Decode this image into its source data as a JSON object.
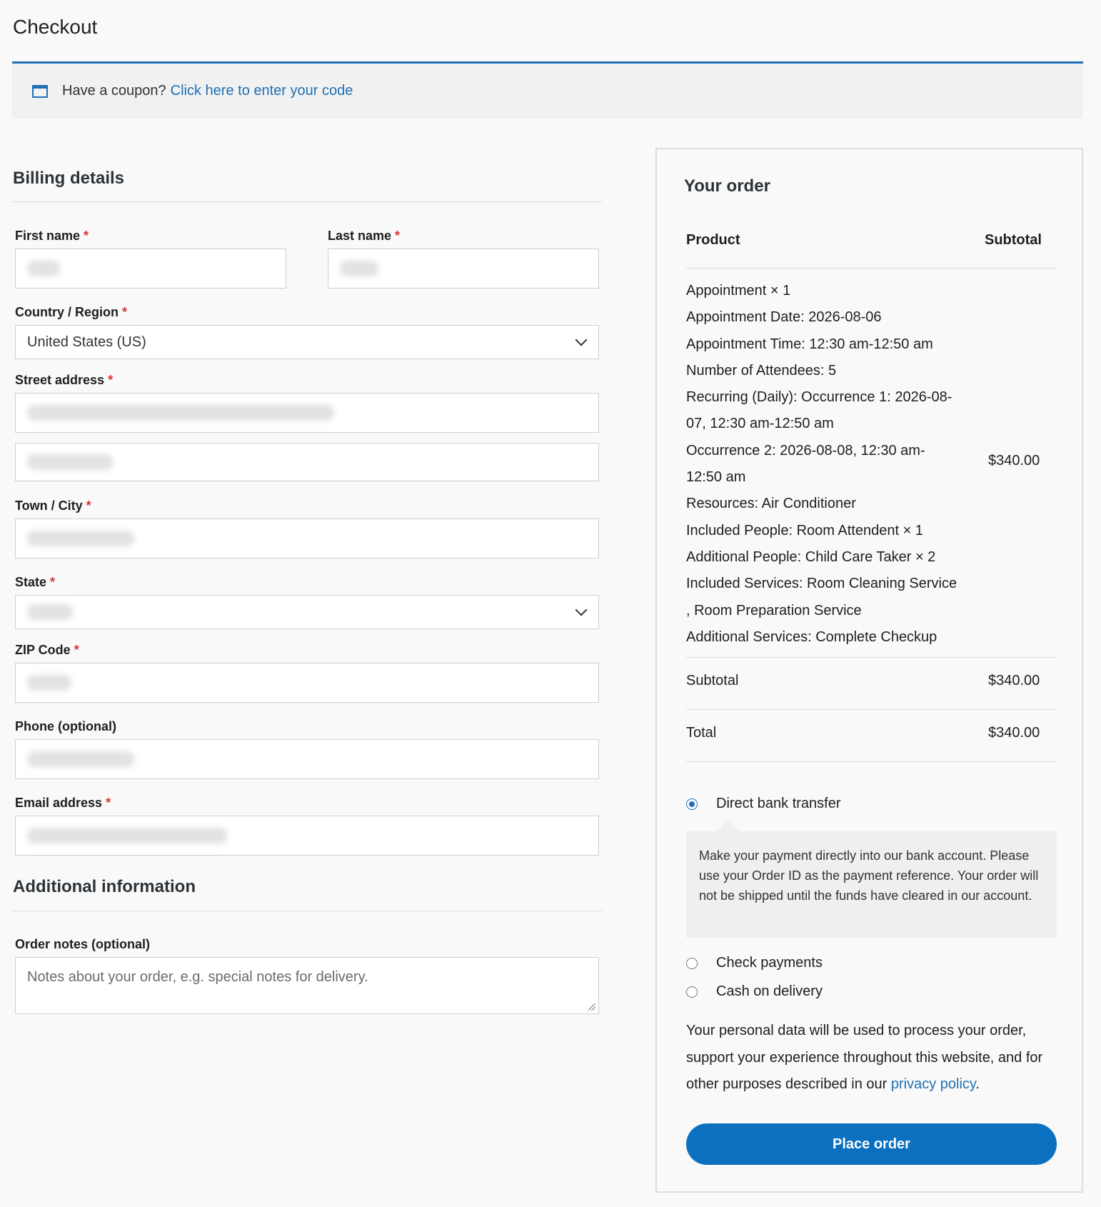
{
  "page": {
    "title": "Checkout"
  },
  "coupon": {
    "prompt": "Have a coupon?",
    "link": "Click here to enter your code"
  },
  "billing": {
    "heading": "Billing details",
    "fields": {
      "first_name": {
        "label": "First name"
      },
      "last_name": {
        "label": "Last name"
      },
      "country": {
        "label": "Country / Region",
        "value": "United States (US)"
      },
      "street": {
        "label": "Street address"
      },
      "city": {
        "label": "Town / City"
      },
      "state": {
        "label": "State"
      },
      "zip": {
        "label": "ZIP Code"
      },
      "phone": {
        "label": "Phone (optional)"
      },
      "email": {
        "label": "Email address"
      }
    },
    "required_marker": "*"
  },
  "additional": {
    "heading": "Additional information",
    "notes_label": "Order notes (optional)",
    "notes_placeholder": "Notes about your order, e.g. special notes for delivery."
  },
  "order": {
    "heading": "Your order",
    "col_product": "Product",
    "col_subtotal": "Subtotal",
    "item": {
      "name": "Appointment",
      "qty": "× 1",
      "details": [
        {
          "k": "Appointment Date:",
          "v": "2026-08-06"
        },
        {
          "k": "Appointment Time:",
          "v": "12:30 am-12:50 am"
        },
        {
          "k": "Number of Attendees:",
          "v": "5"
        },
        {
          "k": "Recurring (Daily):",
          "v": "Occurrence 1: 2026-08-"
        },
        {
          "k": "",
          "v": "07, 12:30 am-12:50 am"
        },
        {
          "k": "",
          "v": "Occurrence 2: 2026-08-08, 12:30 am-"
        },
        {
          "k": "",
          "v": "12:50 am"
        },
        {
          "k": "Resources:",
          "v": "Air Conditioner"
        },
        {
          "k": "Included People:",
          "v": "Room Attendent × 1"
        },
        {
          "k": "Additional People:",
          "v": "Child Care Taker × 2"
        },
        {
          "k": "Included Services:",
          "v": "Room Cleaning Service"
        },
        {
          "k": "",
          "v": ", Room Preparation Service"
        },
        {
          "k": "Additional Services:",
          "v": "Complete Checkup"
        }
      ],
      "price": "$340.00"
    },
    "subtotal_label": "Subtotal",
    "subtotal_value": "$340.00",
    "total_label": "Total",
    "total_value": "$340.00"
  },
  "payment": {
    "methods": [
      {
        "label": "Direct bank transfer",
        "selected": true
      },
      {
        "label": "Check payments",
        "selected": false
      },
      {
        "label": "Cash on delivery",
        "selected": false
      }
    ],
    "bank_description": "Make your payment directly into our bank account. Please use your Order ID as the payment reference. Your order will not be shipped until the funds have cleared in our account."
  },
  "privacy": {
    "text": "Your personal data will be used to process your order, support your experience throughout this website, and for other purposes described in our",
    "link": "privacy policy",
    "end": "."
  },
  "place_order": {
    "label": "Place order"
  },
  "colors": {
    "accent": "#1f6fb5",
    "button": "#0b70bf",
    "required": "#d63638"
  }
}
